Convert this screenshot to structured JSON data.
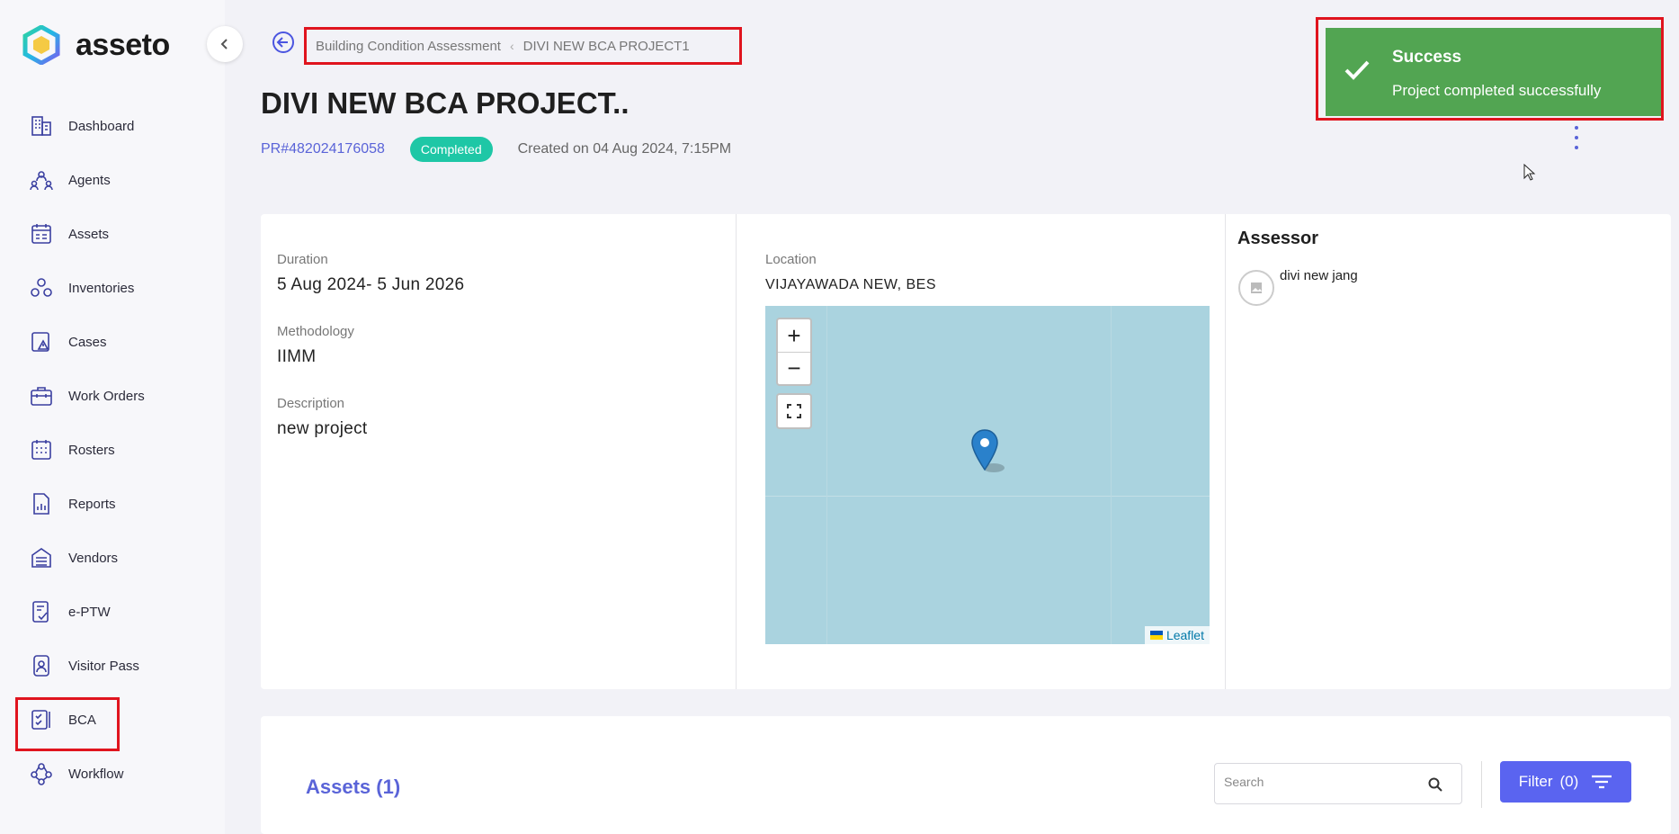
{
  "brand": {
    "name": "asseto"
  },
  "sidebar": {
    "items": [
      {
        "label": "Dashboard",
        "icon": "dashboard-building-icon"
      },
      {
        "label": "Agents",
        "icon": "agents-icon"
      },
      {
        "label": "Assets",
        "icon": "assets-icon"
      },
      {
        "label": "Inventories",
        "icon": "inventories-icon"
      },
      {
        "label": "Cases",
        "icon": "cases-icon"
      },
      {
        "label": "Work Orders",
        "icon": "work-orders-icon"
      },
      {
        "label": "Rosters",
        "icon": "rosters-icon"
      },
      {
        "label": "Reports",
        "icon": "reports-icon"
      },
      {
        "label": "Vendors",
        "icon": "vendors-icon"
      },
      {
        "label": "e-PTW",
        "icon": "eptw-icon"
      },
      {
        "label": "Visitor Pass",
        "icon": "visitor-pass-icon"
      },
      {
        "label": "BCA",
        "icon": "bca-icon"
      },
      {
        "label": "Workflow",
        "icon": "workflow-icon"
      }
    ]
  },
  "breadcrumb": {
    "parent": "Building Condition Assessment",
    "current": "DIVI NEW BCA PROJECT1"
  },
  "project": {
    "title": "DIVI NEW BCA PROJECT..",
    "id": "PR#482024176058",
    "status": "Completed",
    "created": "Created on 04 Aug 2024, 7:15PM"
  },
  "toast": {
    "title": "Success",
    "message": "Project completed successfully"
  },
  "details": {
    "duration_label": "Duration",
    "duration": "5 Aug 2024- 5 Jun 2026",
    "methodology_label": "Methodology",
    "methodology": "IIMM",
    "description_label": "Description",
    "description": "new project"
  },
  "location": {
    "label": "Location",
    "value": "VIJAYAWADA NEW, BES",
    "map": {
      "zoom_in": "+",
      "zoom_out": "−",
      "attribution": "Leaflet"
    }
  },
  "assessor": {
    "heading": "Assessor",
    "name": "divi new jang"
  },
  "assets": {
    "title": "Assets (1)",
    "search_placeholder": "Search",
    "filter_label": "Filter",
    "filter_count": "(0)"
  },
  "colors": {
    "accent": "#5a64f0",
    "success": "#52a552",
    "status_completed": "#1ec7a6",
    "highlight": "#e0141e"
  }
}
